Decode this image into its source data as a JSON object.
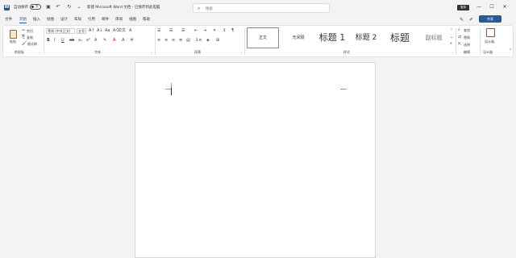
{
  "titlebar": {
    "autosave_label": "自动保存",
    "autosave_state": "关",
    "doc_title": "新建 Microsoft Word 文档 - 已保存到此电脑",
    "search_placeholder": "搜索",
    "login_label": "登录",
    "icons": [
      "word-logo",
      "save-icon",
      "undo-icon",
      "redo-icon",
      "customize-icon"
    ],
    "window_controls": [
      "minimize",
      "maximize",
      "close"
    ]
  },
  "tabs": {
    "items": [
      "文件",
      "开始",
      "插入",
      "绘图",
      "设计",
      "布局",
      "引用",
      "邮件",
      "审阅",
      "视图",
      "帮助"
    ],
    "active": "开始",
    "share_label": "共享"
  },
  "ribbon": {
    "clipboard": {
      "paste_label": "粘贴",
      "cut_label": "剪切",
      "copy_label": "复制",
      "format_painter_label": "格式刷",
      "group_label": "剪贴板"
    },
    "font": {
      "font_name": "等线 (中文正文)",
      "font_size": "五号",
      "group_label": "字体"
    },
    "paragraph": {
      "group_label": "段落"
    },
    "styles": {
      "items": [
        "正文",
        "无间隔",
        "标题 1",
        "标题 2",
        "标题",
        "副标题"
      ],
      "selected": "正文",
      "group_label": "样式"
    },
    "editing": {
      "find_label": "查找",
      "replace_label": "替换",
      "select_label": "选择",
      "group_label": "编辑"
    },
    "designer": {
      "label": "设计器",
      "group_label": "设计器"
    }
  },
  "colors": {
    "accent": "#2b579a",
    "chrome": "#f3f3f3",
    "designer": "#d13438"
  }
}
